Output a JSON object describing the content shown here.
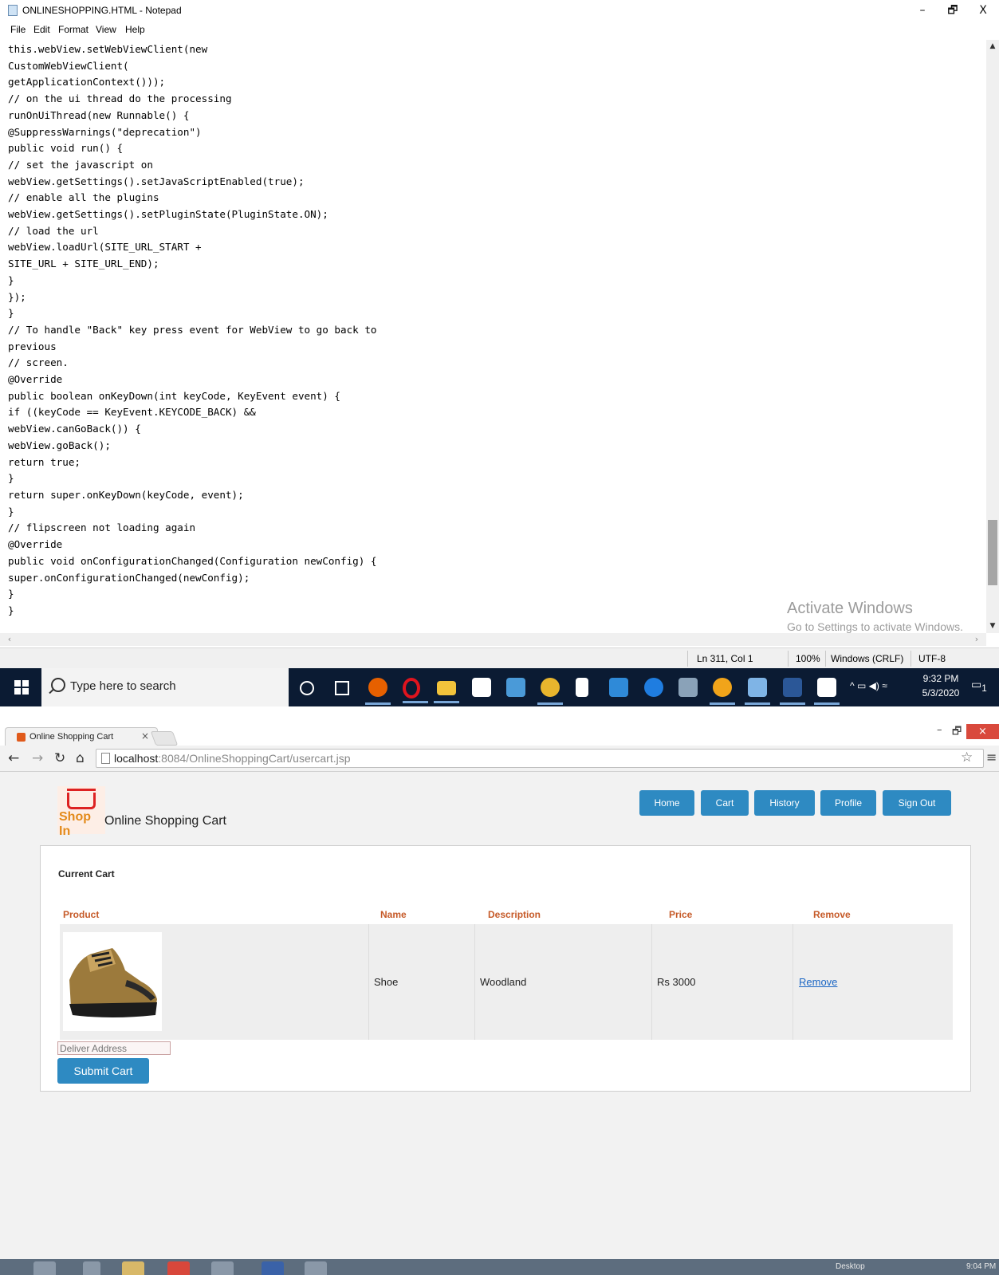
{
  "notepad": {
    "title": "ONLINESHOPPING.HTML - Notepad",
    "window_controls": {
      "minimize": "–",
      "maximize": "🗗",
      "close": "X"
    },
    "menu": [
      "File",
      "Edit",
      "Format",
      "View",
      "Help"
    ],
    "text": "this.webView.setWebViewClient(new\nCustomWebViewClient(\ngetApplicationContext()));\n// on the ui thread do the processing\nrunOnUiThread(new Runnable() {\n@SuppressWarnings(\"deprecation\")\npublic void run() {\n// set the javascript on\nwebView.getSettings().setJavaScriptEnabled(true);\n// enable all the plugins\nwebView.getSettings().setPluginState(PluginState.ON);\n// load the url\nwebView.loadUrl(SITE_URL_START +\nSITE_URL + SITE_URL_END);\n}\n});\n}\n// To handle \"Back\" key press event for WebView to go back to\nprevious\n// screen.\n@Override\npublic boolean onKeyDown(int keyCode, KeyEvent event) {\nif ((keyCode == KeyEvent.KEYCODE_BACK) &&\nwebView.canGoBack()) {\nwebView.goBack();\nreturn true;\n}\nreturn super.onKeyDown(keyCode, event);\n}\n// flipscreen not loading again\n@Override\npublic void onConfigurationChanged(Configuration newConfig) {\nsuper.onConfigurationChanged(newConfig);\n}\n}",
    "watermark": {
      "line1": "Activate Windows",
      "line2": "Go to Settings to activate Windows."
    },
    "status": {
      "position": "Ln 311, Col 1",
      "zoom": "100%",
      "line_endings": "Windows (CRLF)",
      "encoding": "UTF-8"
    },
    "scroll_position": 0.93
  },
  "taskbar": {
    "search_placeholder": "Type here to search",
    "icons": [
      "cortana-icon",
      "task-view-icon",
      "firefox-icon",
      "opera-icon",
      "file-explorer-icon",
      "store-icon",
      "app-icon",
      "chrome-icon",
      "document-icon",
      "mail-icon",
      "edge-icon",
      "photo-viewer-icon",
      "brave-icon",
      "notepad-icon",
      "word-icon",
      "photos-icon"
    ],
    "time": "9:32 PM",
    "date": "5/3/2020",
    "notification_count": "1"
  },
  "browser": {
    "tab_title": "Online Shopping Cart",
    "tab_close": "×",
    "url_host": "localhost",
    "url_path": ":8084/OnlineShoppingCart/usercart.jsp",
    "window_controls": {
      "minimize": "–",
      "maximize": "🗗",
      "close": "×"
    },
    "page": {
      "logo_text": "Shop In",
      "site_name": "Online Shopping Cart",
      "nav": [
        "Home",
        "Cart",
        "History",
        "Profile",
        "Sign Out"
      ],
      "heading": "Current Cart",
      "columns": [
        "Product",
        "Name",
        "Description",
        "Price",
        "Remove"
      ],
      "rows": [
        {
          "name": "Shoe",
          "description": "Woodland",
          "price": "Rs 3000",
          "remove": "Remove"
        }
      ],
      "address_placeholder": "Deliver Address",
      "submit_label": "Submit Cart"
    }
  },
  "taskbar2": {
    "desktop_label": "Desktop",
    "time": "9:04 PM"
  }
}
